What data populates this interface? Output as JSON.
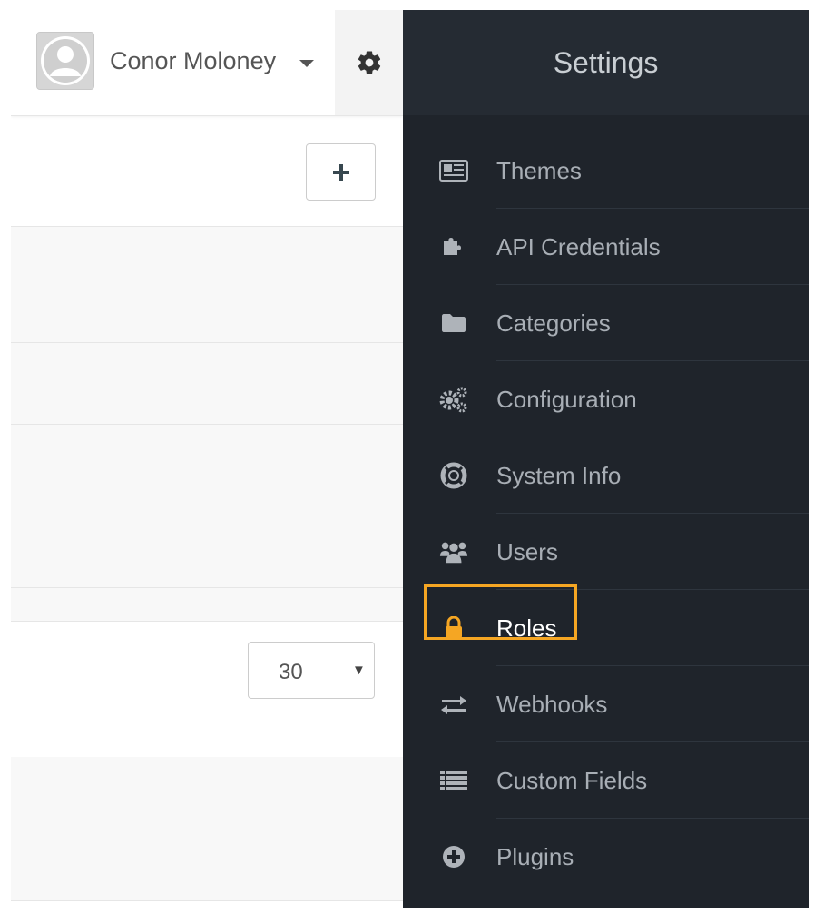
{
  "header": {
    "user_name": "Conor Moloney"
  },
  "toolbar": {
    "add_label": "+"
  },
  "list": {
    "per_page_value": "30"
  },
  "sidebar": {
    "title": "Settings",
    "active_item": "Roles",
    "highlight_color": "#f5a623",
    "items": [
      {
        "label": "Themes",
        "icon": "newspaper-icon"
      },
      {
        "label": "API Credentials",
        "icon": "puzzle-icon"
      },
      {
        "label": "Categories",
        "icon": "folder-icon"
      },
      {
        "label": "Configuration",
        "icon": "cogs-icon"
      },
      {
        "label": "System Info",
        "icon": "life-ring-icon"
      },
      {
        "label": "Users",
        "icon": "users-icon"
      },
      {
        "label": "Roles",
        "icon": "lock-icon"
      },
      {
        "label": "Webhooks",
        "icon": "exchange-icon"
      },
      {
        "label": "Custom Fields",
        "icon": "list-icon"
      },
      {
        "label": "Plugins",
        "icon": "plus-circle-icon"
      }
    ]
  }
}
